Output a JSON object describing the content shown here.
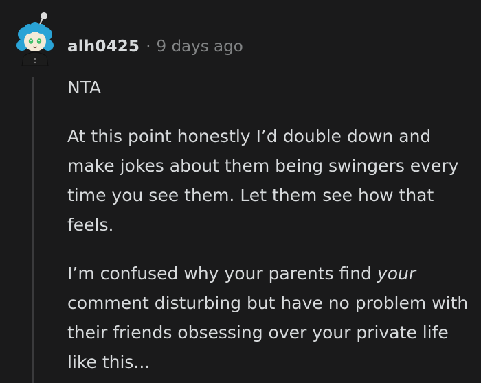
{
  "comment": {
    "author": "alh0425",
    "separator": "·",
    "timestamp": "9 days ago",
    "avatar_icon": "snoo-avatar-icon",
    "paragraphs": [
      "NTA",
      "At this point honestly I’d double down and make jokes about them being swingers every time you see them. Let them see how that feels."
    ],
    "paragraph3": {
      "before": "I’m confused why your parents find ",
      "emphasis": "your",
      "after": " comment disturbing but have no problem with their friends obsessing over your private life like this..."
    }
  },
  "colors": {
    "background": "#1a1a1b",
    "text": "#d7dadc",
    "meta": "#818384",
    "thread_line": "#3a3a3c",
    "avatar_hair": "#2aa3d6"
  }
}
